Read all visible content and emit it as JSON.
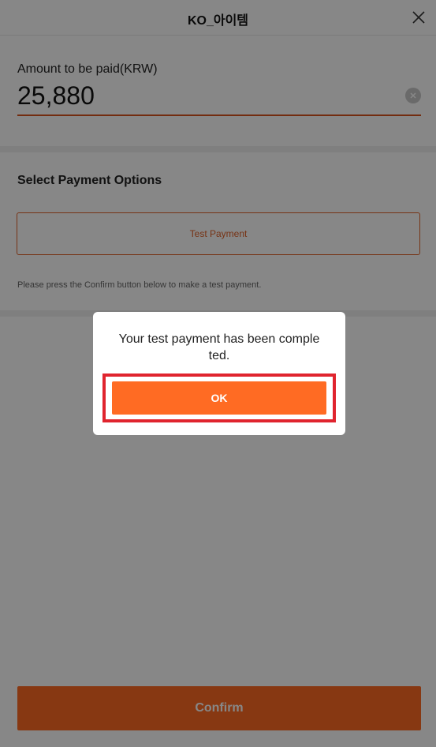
{
  "header": {
    "title": "KO_아이템",
    "close_icon": "close-icon"
  },
  "amount": {
    "label": "Amount to be paid(KRW)",
    "value": "25,880",
    "clear_icon": "clear-icon"
  },
  "payment": {
    "title": "Select Payment Options",
    "option_label": "Test Payment",
    "note": "Please press the Confirm button below to make a test payment."
  },
  "footer": {
    "confirm_label": "Confirm"
  },
  "dialog": {
    "message": "Your test payment has been comple ted.",
    "ok_label": "OK"
  },
  "colors": {
    "accent": "#ff6b23",
    "accent_dark": "#d9541e",
    "highlight": "#e0242e"
  }
}
